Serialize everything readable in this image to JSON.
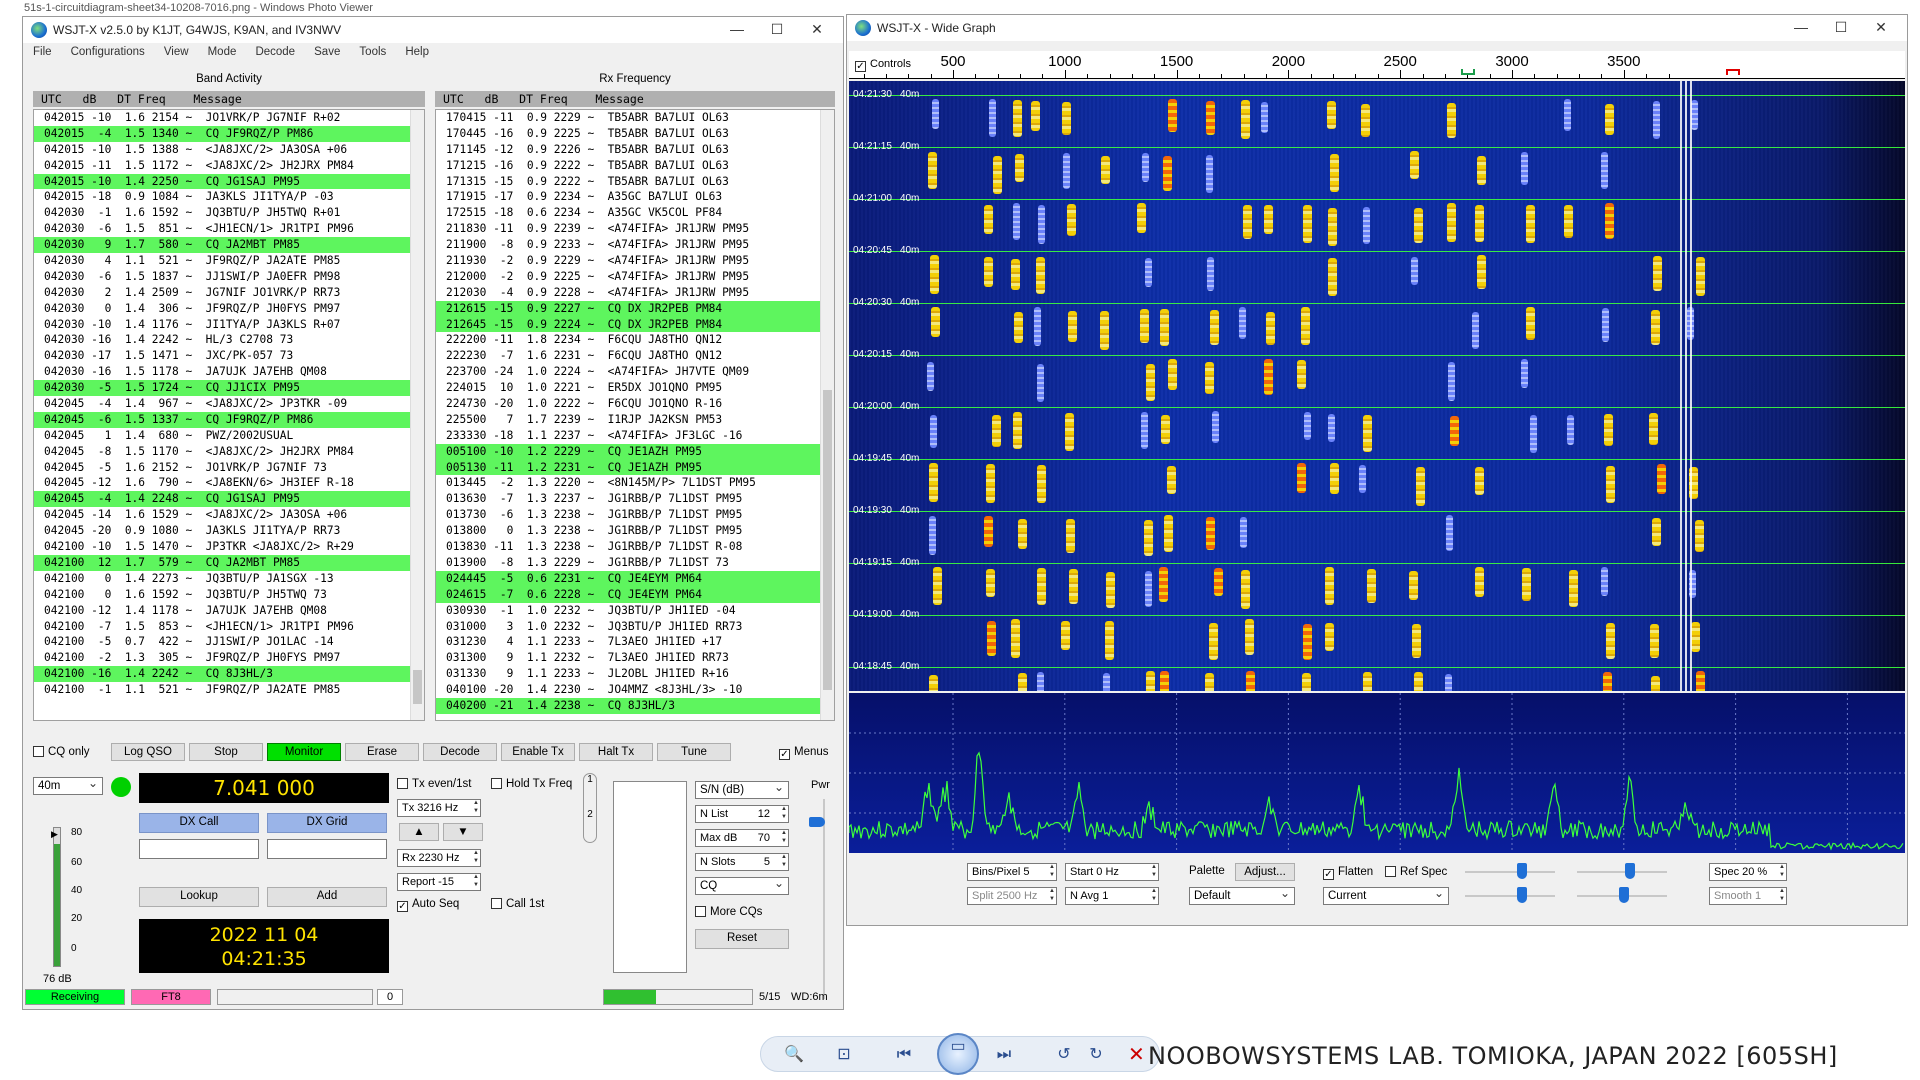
{
  "photo_viewer": {
    "title": "51s-1-circuitdiagram-sheet34-10208-7016.png - Windows Photo Viewer",
    "credit": "NOOBOWSYSTEMS LAB. TOMIOKA, JAPAN 2022 [605SH]"
  },
  "main_window": {
    "title": "WSJT-X   v2.5.0   by K1JT, G4WJS, K9AN, and IV3NWV",
    "menu": [
      "File",
      "Configurations",
      "View",
      "Mode",
      "Decode",
      "Save",
      "Tools",
      "Help"
    ],
    "band_activity": {
      "title": "Band Activity",
      "header": "UTC   dB   DT Freq    Message",
      "rows": [
        {
          "t": "042015 -10  1.6 2154 ~  JO1VRK/P JG7NIF R+02",
          "hl": false
        },
        {
          "t": "042015  -4  1.5 1340 ~  CQ JF9RQZ/P PM86",
          "hl": true
        },
        {
          "t": "042015 -10  1.5 1388 ~  <JA8JXC/2> JA3OSA +06",
          "hl": false
        },
        {
          "t": "042015 -11  1.5 1172 ~  <JA8JXC/2> JH2JRX PM84",
          "hl": false
        },
        {
          "t": "042015 -10  1.4 2250 ~  CQ JG1SAJ PM95",
          "hl": true
        },
        {
          "t": "042015 -18  0.9 1084 ~  JA3KLS JI1TYA/P -03",
          "hl": false
        },
        {
          "t": "042030  -1  1.6 1592 ~  JQ3BTU/P JH5TWQ R+01",
          "hl": false
        },
        {
          "t": "042030  -6  1.5  851 ~  <JH1ECN/1> JR1TPI PM96",
          "hl": false
        },
        {
          "t": "042030   9  1.7  580 ~  CQ JA2MBT PM85",
          "hl": true
        },
        {
          "t": "042030   4  1.1  521 ~  JF9RQZ/P JA2ATE PM85",
          "hl": false
        },
        {
          "t": "042030  -6  1.5 1837 ~  JJ1SWI/P JA0EFR PM98",
          "hl": false
        },
        {
          "t": "042030   2  1.4 2509 ~  JG7NIF JO1VRK/P RR73",
          "hl": false
        },
        {
          "t": "042030   0  1.4  306 ~  JF9RQZ/P JH0FYS PM97",
          "hl": false
        },
        {
          "t": "042030 -10  1.4 1176 ~  JI1TYA/P JA3KLS R+07",
          "hl": false
        },
        {
          "t": "042030 -16  1.4 2242 ~  HL/3 C2708 73",
          "hl": false
        },
        {
          "t": "042030 -17  1.5 1471 ~  JXC/PK-057 73",
          "hl": false
        },
        {
          "t": "042030 -16  1.5 1178 ~  JA7UJK JA7EHB QM08",
          "hl": false
        },
        {
          "t": "042030  -5  1.5 1724 ~  CQ JJ1CIX PM95",
          "hl": true
        },
        {
          "t": "042045  -4  1.4  967 ~  <JA8JXC/2> JP3TKR -09",
          "hl": false
        },
        {
          "t": "042045  -6  1.5 1337 ~  CQ JF9RQZ/P PM86",
          "hl": true
        },
        {
          "t": "042045   1  1.4  680 ~  PWZ/2002USUAL",
          "hl": false
        },
        {
          "t": "042045  -8  1.5 1170 ~  <JA8JXC/2> JH2JRX PM84",
          "hl": false
        },
        {
          "t": "042045  -5  1.6 2152 ~  JO1VRK/P JG7NIF 73",
          "hl": false
        },
        {
          "t": "042045 -12  1.6  790 ~  <JA8EKN/6> JH3IEF R-18",
          "hl": false
        },
        {
          "t": "042045  -4  1.4 2248 ~  CQ JG1SAJ PM95",
          "hl": true
        },
        {
          "t": "042045 -14  1.6 1529 ~  <JA8JXC/2> JA3OSA +06",
          "hl": false
        },
        {
          "t": "042045 -20  0.9 1080 ~  JA3KLS JI1TYA/P RR73",
          "hl": false
        },
        {
          "t": "042100 -10  1.5 1470 ~  JP3TKR <JA8JXC/2> R+29",
          "hl": false
        },
        {
          "t": "042100  12  1.7  579 ~  CQ JA2MBT PM85",
          "hl": true
        },
        {
          "t": "042100   0  1.4 2273 ~  JQ3BTU/P JA1SGX -13",
          "hl": false
        },
        {
          "t": "042100   0  1.6 1592 ~  JQ3BTU/P JH5TWQ 73",
          "hl": false
        },
        {
          "t": "042100 -12  1.4 1178 ~  JA7UJK JA7EHB QM08",
          "hl": false
        },
        {
          "t": "042100  -7  1.5  853 ~  <JH1ECN/1> JR1TPI PM96",
          "hl": false
        },
        {
          "t": "042100  -5  0.7  422 ~  JJ1SWI/P JO1LAC -14",
          "hl": false
        },
        {
          "t": "042100  -2  1.3  305 ~  JF9RQZ/P JH0FYS PM97",
          "hl": false
        },
        {
          "t": "042100 -16  1.4 2242 ~  CQ 8J3HL/3",
          "hl": true
        },
        {
          "t": "042100  -1  1.1  521 ~  JF9RQZ/P JA2ATE PM85",
          "hl": false
        }
      ]
    },
    "rx_frequency": {
      "title": "Rx Frequency",
      "header": "UTC   dB   DT Freq    Message",
      "rows": [
        {
          "t": "170415 -11  0.9 2229 ~  TB5ABR BA7LUI OL63",
          "hl": false
        },
        {
          "t": "170445 -16  0.9 2225 ~  TB5ABR BA7LUI OL63",
          "hl": false
        },
        {
          "t": "171145 -12  0.9 2226 ~  TB5ABR BA7LUI OL63",
          "hl": false
        },
        {
          "t": "171215 -16  0.9 2222 ~  TB5ABR BA7LUI OL63",
          "hl": false
        },
        {
          "t": "171315 -15  0.9 2222 ~  TB5ABR BA7LUI OL63",
          "hl": false
        },
        {
          "t": "171915 -17  0.9 2234 ~  A35GC BA7LUI OL63",
          "hl": false
        },
        {
          "t": "172515 -18  0.6 2234 ~  A35GC VK5COL PF84",
          "hl": false
        },
        {
          "t": "211830 -11  0.9 2239 ~  <A74FIFA> JR1JRW PM95",
          "hl": false
        },
        {
          "t": "211900  -8  0.9 2233 ~  <A74FIFA> JR1JRW PM95",
          "hl": false
        },
        {
          "t": "211930  -2  0.9 2229 ~  <A74FIFA> JR1JRW PM95",
          "hl": false
        },
        {
          "t": "212000  -2  0.9 2225 ~  <A74FIFA> JR1JRW PM95",
          "hl": false
        },
        {
          "t": "212030  -4  0.9 2228 ~  <A74FIFA> JR1JRW PM95",
          "hl": false
        },
        {
          "t": "212615 -15  0.9 2227 ~  CQ DX JR2PEB PM84",
          "hl": true
        },
        {
          "t": "212645 -15  0.9 2224 ~  CQ DX JR2PEB PM84",
          "hl": true
        },
        {
          "t": "222200 -11  1.8 2234 ~  F6CQU JA8THO QN12",
          "hl": false
        },
        {
          "t": "222230  -7  1.6 2231 ~  F6CQU JA8THO QN12",
          "hl": false
        },
        {
          "t": "223700 -24  1.0 2224 ~  <A74FIFA> JH7VTE QM09",
          "hl": false
        },
        {
          "t": "224015  10  1.0 2221 ~  ER5DX JO1QNO PM95",
          "hl": false
        },
        {
          "t": "224730 -20  1.0 2222 ~  F6CQU JO1QNO R-16",
          "hl": false
        },
        {
          "t": "225500   7  1.7 2239 ~  I1RJP JA2KSN PM53",
          "hl": false
        },
        {
          "t": "233330 -18  1.1 2237 ~  <A74FIFA> JF3LGC -16",
          "hl": false
        },
        {
          "t": "005100 -10  1.2 2229 ~  CQ JE1AZH PM95",
          "hl": true
        },
        {
          "t": "005130 -11  1.2 2231 ~  CQ JE1AZH PM95",
          "hl": true
        },
        {
          "t": "013445  -2  1.3 2220 ~  <8N145M/P> 7L1DST PM95",
          "hl": false
        },
        {
          "t": "013630  -7  1.3 2237 ~  JG1RBB/P 7L1DST PM95",
          "hl": false
        },
        {
          "t": "013730  -6  1.3 2238 ~  JG1RBB/P 7L1DST PM95",
          "hl": false
        },
        {
          "t": "013800   0  1.3 2238 ~  JG1RBB/P 7L1DST PM95",
          "hl": false
        },
        {
          "t": "013830 -11  1.3 2238 ~  JG1RBB/P 7L1DST R-08",
          "hl": false
        },
        {
          "t": "013900  -8  1.3 2229 ~  JG1RBB/P 7L1DST 73",
          "hl": false
        },
        {
          "t": "024445  -5  0.6 2231 ~  CQ JE4EYM PM64",
          "hl": true
        },
        {
          "t": "024615  -7  0.6 2228 ~  CQ JE4EYM PM64",
          "hl": true
        },
        {
          "t": "030930  -1  1.0 2232 ~  JQ3BTU/P JH1IED -04",
          "hl": false
        },
        {
          "t": "031000   3  1.0 2232 ~  JQ3BTU/P JH1IED RR73",
          "hl": false
        },
        {
          "t": "031230   4  1.1 2233 ~  7L3AEO JH1IED +17",
          "hl": false
        },
        {
          "t": "031300   9  1.1 2232 ~  7L3AEO JH1IED RR73",
          "hl": false
        },
        {
          "t": "031330   9  1.1 2233 ~  JL2OBL JH1IED R+16",
          "hl": false
        },
        {
          "t": "040100 -20  1.4 2230 ~  JO4MMZ <8J3HL/3> -10",
          "hl": false
        },
        {
          "t": "040200 -21  1.4 2238 ~  CQ 8J3HL/3",
          "hl": true
        }
      ]
    },
    "buttons": {
      "cq_only": "CQ only",
      "log_qso": "Log QSO",
      "stop": "Stop",
      "monitor": "Monitor",
      "erase": "Erase",
      "decode": "Decode",
      "enable_tx": "Enable Tx",
      "halt_tx": "Halt Tx",
      "tune": "Tune",
      "menus": "Menus",
      "dx_call": "DX Call",
      "dx_grid": "DX Grid",
      "lookup": "Lookup",
      "add": "Add",
      "reset": "Reset"
    },
    "band": "40m",
    "frequency": "7.041 000",
    "tx_even": "Tx even/1st",
    "hold_tx_freq": "Hold Tx Freq",
    "tx_hz": "Tx  3216  Hz",
    "rx_hz": "Rx  2230  Hz",
    "report": "Report  -15",
    "auto_seq": "Auto Seq",
    "call_1st": "Call 1st",
    "date": "2022 11 04",
    "time": "04:21:35",
    "meter_ticks": [
      "80",
      "60",
      "40",
      "20",
      "0"
    ],
    "meter_level": "76 dB",
    "tab_labels": [
      "1",
      "2"
    ],
    "right_panel": {
      "sn": "S/N (dB)",
      "nlist": "N List",
      "nlist_val": "12",
      "maxdb": "Max dB",
      "maxdb_val": "70",
      "nslots": "N Slots",
      "nslots_val": "5",
      "cq": "CQ",
      "more_cqs": "More CQs",
      "pwr": "Pwr"
    },
    "status": {
      "receiving": "Receiving",
      "mode": "FT8",
      "count": "0",
      "slots": "5/15",
      "wd": "WD:6m",
      "progress": 0.35
    }
  },
  "wide_graph": {
    "title": "WSJT-X - Wide Graph",
    "controls_label": "Controls",
    "scale_labels": [
      "500",
      "1000",
      "1500",
      "2000",
      "2500",
      "3000",
      "3500"
    ],
    "scale_values": [
      500,
      1000,
      1500,
      2000,
      2500,
      3000,
      3500
    ],
    "time_labels": [
      "04:21:30",
      "04:21:15",
      "04:21:00",
      "04:20:45",
      "04:20:30",
      "04:20:15",
      "04:20:00",
      "04:19:45",
      "04:19:30",
      "04:19:15",
      "04:19:00",
      "04:18:45"
    ],
    "band_label": "40m",
    "controls": {
      "bins_pixel": "Bins/Pixel  5",
      "start": "Start  0 Hz",
      "palette": "Palette",
      "adjust": "Adjust...",
      "flatten": "Flatten",
      "ref_spec": "Ref Spec",
      "spec": "Spec  20 %",
      "split": "Split  2500  Hz",
      "navg": "N Avg  1",
      "palette_value": "Default",
      "current": "Current",
      "smooth": "Smooth   1"
    }
  }
}
